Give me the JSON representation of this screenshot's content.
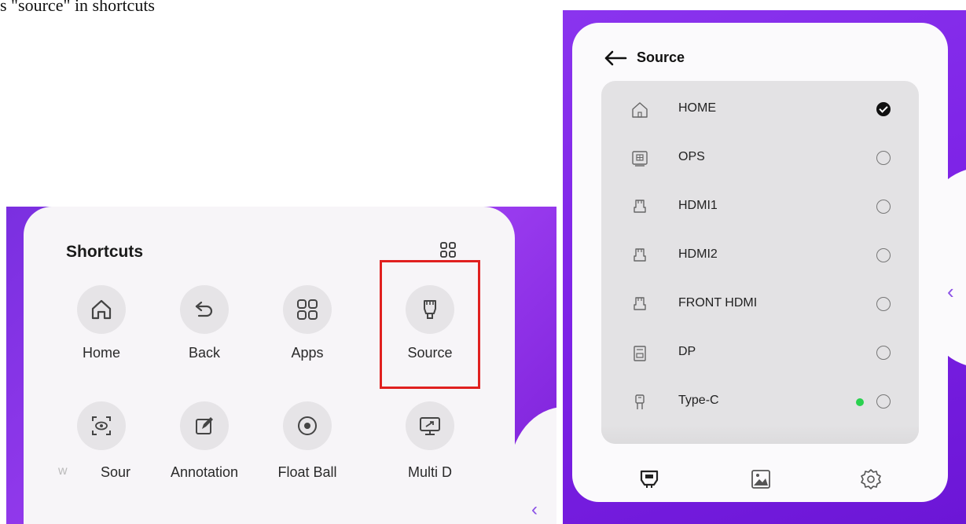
{
  "caption": "s \"source\" in shortcuts",
  "shortcuts": {
    "title": "Shortcuts",
    "items": [
      {
        "label": "Home",
        "icon": "home-icon"
      },
      {
        "label": "Back",
        "icon": "back-icon"
      },
      {
        "label": "Apps",
        "icon": "apps-icon"
      },
      {
        "label": "Source",
        "icon": "source-icon"
      },
      {
        "label": "w",
        "icon": "screen-eye-icon"
      },
      {
        "label": "Sour",
        "icon": "source-icon"
      },
      {
        "label": "Annotation",
        "icon": "annotation-icon"
      },
      {
        "label": "Float Ball",
        "icon": "float-ball-icon"
      },
      {
        "label": "Multi D",
        "icon": "multi-display-icon"
      }
    ]
  },
  "source": {
    "title": "Source",
    "items": [
      {
        "label": "HOME",
        "icon": "home-icon",
        "selected": true
      },
      {
        "label": "OPS",
        "icon": "ops-icon",
        "selected": false
      },
      {
        "label": "HDMI1",
        "icon": "hdmi-icon",
        "selected": false
      },
      {
        "label": "HDMI2",
        "icon": "hdmi-icon",
        "selected": false
      },
      {
        "label": "FRONT HDMI",
        "icon": "hdmi-icon",
        "selected": false
      },
      {
        "label": "DP",
        "icon": "dp-icon",
        "selected": false
      },
      {
        "label": "Type-C",
        "icon": "type-c-icon",
        "selected": false,
        "active_signal": true
      }
    ],
    "bottom_icons": [
      "source-icon",
      "image-icon",
      "gear-icon"
    ]
  },
  "colors": {
    "accent_purple": "#8a34ee",
    "highlight_red": "#e0201f",
    "signal_green": "#2ad14f"
  }
}
